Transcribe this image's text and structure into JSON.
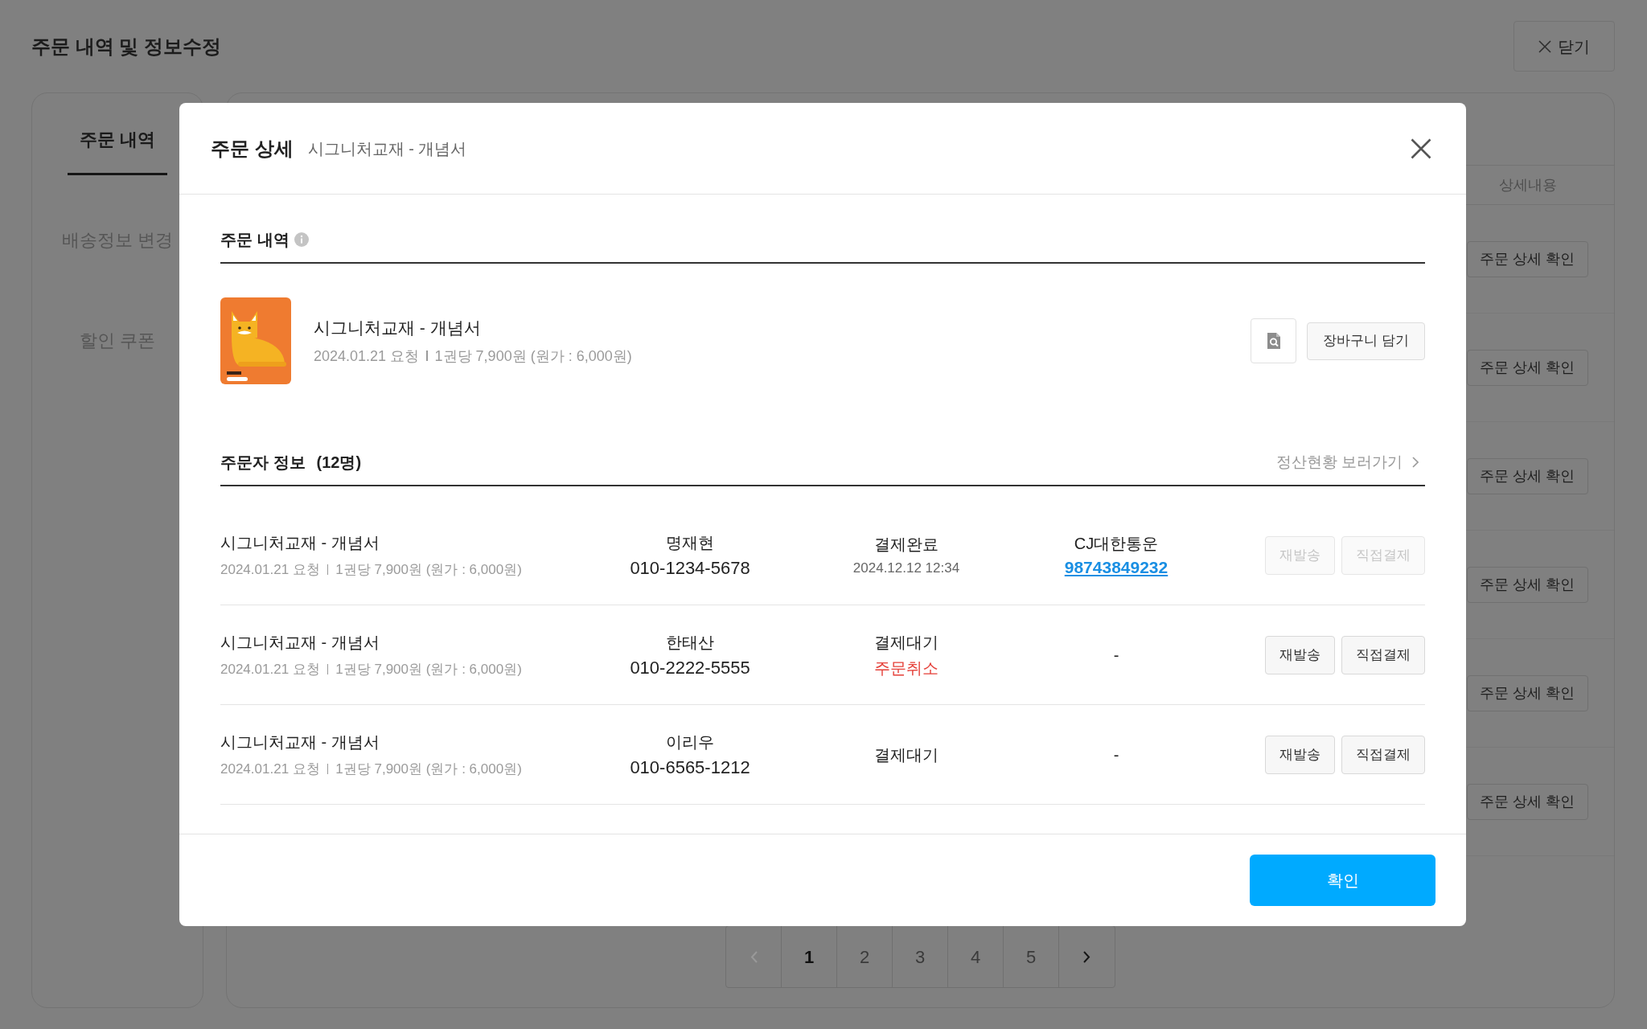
{
  "page": {
    "title": "주문 내역 및 정보수정",
    "close_button": "닫기"
  },
  "sidebar": {
    "items": [
      {
        "label": "주문 내역",
        "selected": true
      },
      {
        "label": "배송정보 변경",
        "selected": false
      },
      {
        "label": "할인 쿠폰",
        "selected": false
      }
    ]
  },
  "table": {
    "columns": [
      "상세내용"
    ],
    "rows": [
      {
        "action": "주문 상세 확인"
      },
      {
        "action": "주문 상세 확인"
      },
      {
        "action": "주문 상세 확인"
      },
      {
        "action": "주문 상세 확인"
      },
      {
        "action": "주문 상세 확인"
      },
      {
        "action": "주문 상세 확인"
      }
    ]
  },
  "pagination": {
    "prev_disabled": true,
    "next_disabled": false,
    "pages": [
      {
        "label": "1",
        "selected": true
      },
      {
        "label": "2",
        "selected": false
      },
      {
        "label": "3",
        "selected": false
      },
      {
        "label": "4",
        "selected": false
      },
      {
        "label": "5",
        "selected": false
      }
    ]
  },
  "modal": {
    "title": "주문 상세",
    "subtitle": "시그니처교재 - 개념서",
    "order_section": {
      "heading": "주문 내역",
      "product": {
        "name": "시그니처교재 - 개념서",
        "request": "2024.01.21 요청",
        "price": "1권당 7,900원 (원가 : 6,000원)",
        "cart_button": "장바구니 담기"
      }
    },
    "orderers": {
      "heading": "주문자 정보",
      "count": "(12명)",
      "link": "정산현황 보러가기",
      "rows": [
        {
          "product": "시그니처교재 - 개념서",
          "request": "2024.01.21 요청",
          "price": "1권당 7,900원 (원가 : 6,000원)",
          "customer": "명재현",
          "phone": "010-1234-5678",
          "status": "결제완료",
          "status_detail": {
            "kind": "date",
            "text": "2024.12.12 12:34"
          },
          "delivery": {
            "kind": "tracked",
            "carrier": "CJ대한통운",
            "tracking": "98743849232"
          },
          "buttons": [
            {
              "label": "재발송",
              "disabled": true
            },
            {
              "label": "직접결제",
              "disabled": true
            }
          ]
        },
        {
          "product": "시그니처교재 - 개념서",
          "request": "2024.01.21 요청",
          "price": "1권당 7,900원 (원가 : 6,000원)",
          "customer": "한태산",
          "phone": "010-2222-5555",
          "status": "결제대기",
          "status_detail": {
            "kind": "cancelled",
            "text": "주문취소"
          },
          "delivery": {
            "kind": "none",
            "text": "-"
          },
          "buttons": [
            {
              "label": "재발송",
              "disabled": false
            },
            {
              "label": "직접결제",
              "disabled": false
            }
          ]
        },
        {
          "product": "시그니처교재 - 개념서",
          "request": "2024.01.21 요청",
          "price": "1권당 7,900원 (원가 : 6,000원)",
          "customer": "이리우",
          "phone": "010-6565-1212",
          "status": "결제대기",
          "delivery": {
            "kind": "none",
            "text": "-"
          },
          "buttons": [
            {
              "label": "재발송",
              "disabled": false
            },
            {
              "label": "직접결제",
              "disabled": false
            }
          ]
        }
      ]
    },
    "confirm_button": "확인"
  }
}
